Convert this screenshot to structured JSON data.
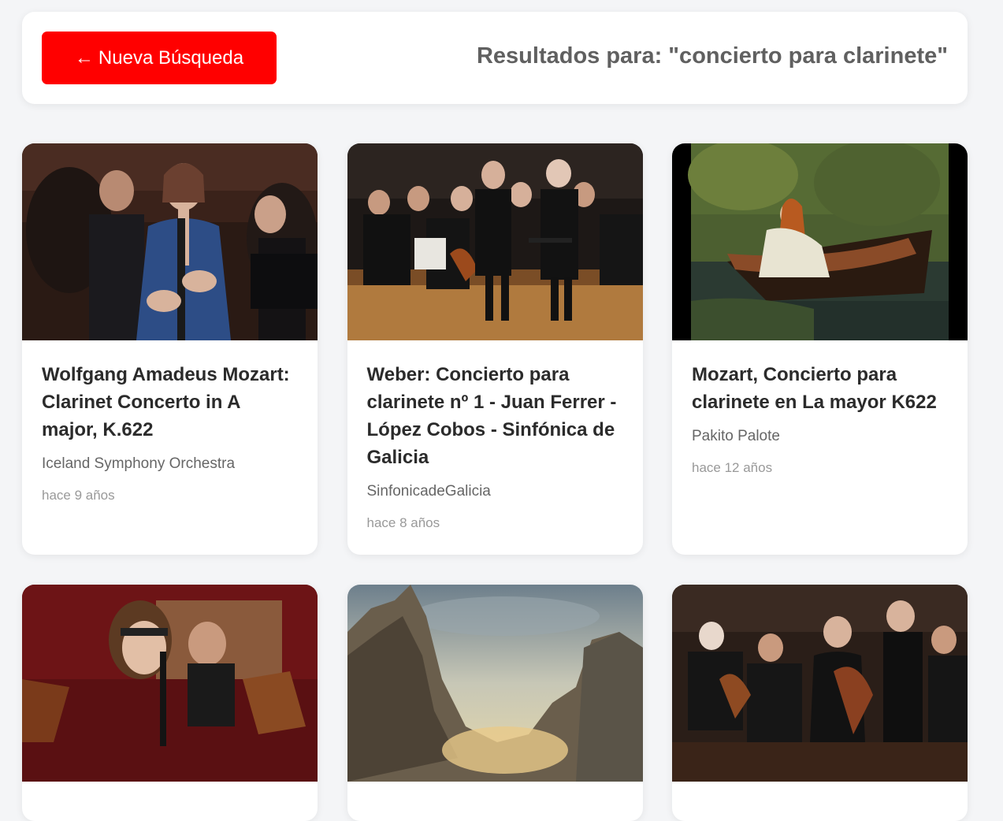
{
  "header": {
    "back_arrow": "←",
    "back_label": "Nueva Búsqueda",
    "results_title": "Resultados para: \"concierto para clarinete\"",
    "accent_color": "#ff0000"
  },
  "results": [
    {
      "title": "Wolfgang Amadeus Mozart: Clarinet Concerto in A major, K.622",
      "channel": "Iceland Symphony Orchestra",
      "time": "hace 9 años",
      "thumbnail": "clarinetist-soloist-with-orchestra"
    },
    {
      "title": "Weber: Concierto para clarinete nº 1 - Juan Ferrer - López Cobos - Sinfónica de Galicia",
      "channel": "SinfonicadeGalicia",
      "time": "hace 8 años",
      "thumbnail": "orchestra-on-stage-applause"
    },
    {
      "title": "Mozart, Concierto para clarinete en La mayor K622",
      "channel": "Pakito Palote",
      "time": "hace 12 años",
      "thumbnail": "painting-lady-in-boat"
    },
    {
      "title": "",
      "channel": "",
      "time": "",
      "thumbnail": "female-clarinetist-with-orchestra"
    },
    {
      "title": "",
      "channel": "",
      "time": "",
      "thumbnail": "mountain-landscape-painting"
    },
    {
      "title": "",
      "channel": "",
      "time": "",
      "thumbnail": "orchestra-with-conductor"
    }
  ]
}
